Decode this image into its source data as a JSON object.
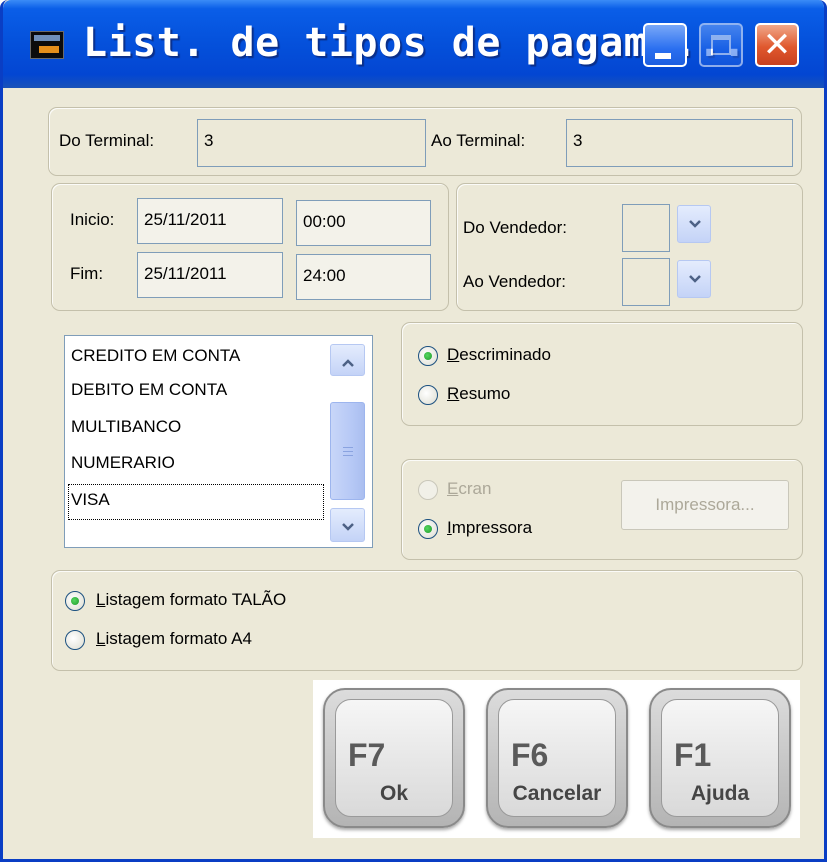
{
  "window": {
    "title": "List. de tipos de pagame...",
    "controls": {
      "minimize_icon": "minimize-icon",
      "maximize_icon": "maximize-icon",
      "close_icon": "close-icon"
    }
  },
  "terminal": {
    "from_label": "Do Terminal:",
    "from_value": "3",
    "to_label": "Ao Terminal:",
    "to_value": "3"
  },
  "period": {
    "start_label": "Inicio:",
    "start_date": "25/11/2011",
    "start_time": "00:00",
    "end_label": "Fim:",
    "end_date": "25/11/2011",
    "end_time": "24:00"
  },
  "seller": {
    "from_label": "Do Vendedor:",
    "from_value": "",
    "to_label": "Ao Vendedor:",
    "to_value": ""
  },
  "payment_types": {
    "items": [
      "CREDITO EM CONTA",
      "DEBITO EM CONTA",
      "MULTIBANCO",
      "NUMERARIO",
      "VISA"
    ],
    "focused_item": "VISA"
  },
  "detail": {
    "option1_first": "D",
    "option1_rest": "escriminado",
    "option2_first": "R",
    "option2_rest": "esumo",
    "selected": "Descriminado"
  },
  "output": {
    "screen_first": "E",
    "screen_rest": "cran",
    "printer_first": "I",
    "printer_rest": "mpressora",
    "printer_button": "Impressora...",
    "selected": "Impressora"
  },
  "format": {
    "option1_first": "L",
    "option1_rest": "istagem formato TALÃO",
    "option2_first": "L",
    "option2_rest": "istagem formato A4",
    "selected": "Listagem formato TALÃO"
  },
  "actions": {
    "ok": {
      "key": "F7",
      "label": "Ok"
    },
    "cancel": {
      "key": "F6",
      "label": "Cancelar"
    },
    "help": {
      "key": "F1",
      "label": "Ajuda"
    }
  },
  "colors": {
    "titlebar": "#0552dc",
    "window_bg": "#ece9d8",
    "radio_checked": "#1f9a2b",
    "close_button": "#e0582e"
  }
}
